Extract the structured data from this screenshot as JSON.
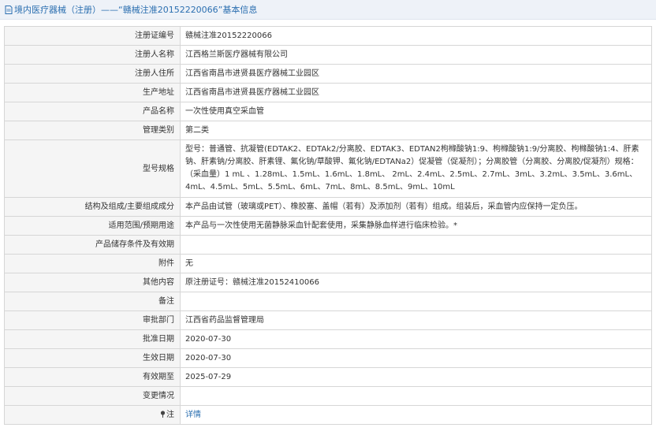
{
  "header": {
    "breadcrumb": "境内医疗器械（注册）——“赣械注准20152220066”基本信息"
  },
  "rows": [
    {
      "label": "注册证编号",
      "value": "赣械注准20152220066"
    },
    {
      "label": "注册人名称",
      "value": "江西格兰斯医疗器械有限公司"
    },
    {
      "label": "注册人住所",
      "value": "江西省南昌市进贤县医疗器械工业园区"
    },
    {
      "label": "生产地址",
      "value": "江西省南昌市进贤县医疗器械工业园区"
    },
    {
      "label": "产品名称",
      "value": "一次性使用真空采血管"
    },
    {
      "label": "管理类别",
      "value": "第二类"
    },
    {
      "label": "型号规格",
      "value": "型号：普通管、抗凝管(EDTAK2、EDTAk2/分离胶、EDTAK3、EDTAN2枸橼酸钠1:9、枸橼酸钠1:9/分离胶、枸橼酸钠1:4、肝素钠、肝素钠/分离胶、肝素锂、氟化钠/草酸钾、氟化钠/EDTANa2）促凝管（促凝剂）；分离胶管（分离胶、分离胶/促凝剂）规格：（采血量）1 mL 、1.28mL、1.5mL、1.6mL、1.8mL、 2mL、2.4mL、2.5mL、2.7mL、3mL、3.2mL、3.5mL、3.6mL、4mL、4.5mL、5mL、5.5mL、6mL、7mL、8mL、8.5mL、9mL、10mL"
    },
    {
      "label": "结构及组成/主要组成成分",
      "value": "本产品由试管（玻璃或PET）、橡胶塞、盖帽（若有）及添加剂（若有）组成。组装后，采血管内应保持一定负压。"
    },
    {
      "label": "适用范围/预期用途",
      "value": "本产品与一次性使用无菌静脉采血针配套使用，采集静脉血样进行临床检验。*"
    },
    {
      "label": "产品储存条件及有效期",
      "value": ""
    },
    {
      "label": "附件",
      "value": "无"
    },
    {
      "label": "其他内容",
      "value": "原注册证号：赣械注准20152410066"
    },
    {
      "label": "备注",
      "value": ""
    },
    {
      "label": "审批部门",
      "value": "江西省药品监督管理局"
    },
    {
      "label": "批准日期",
      "value": "2020-07-30"
    },
    {
      "label": "生效日期",
      "value": "2020-07-30"
    },
    {
      "label": "有效期至",
      "value": "2025-07-29"
    },
    {
      "label": "变更情况",
      "value": ""
    }
  ],
  "footer_row": {
    "label": "注",
    "link": "详情",
    "icon": "pin-icon"
  }
}
